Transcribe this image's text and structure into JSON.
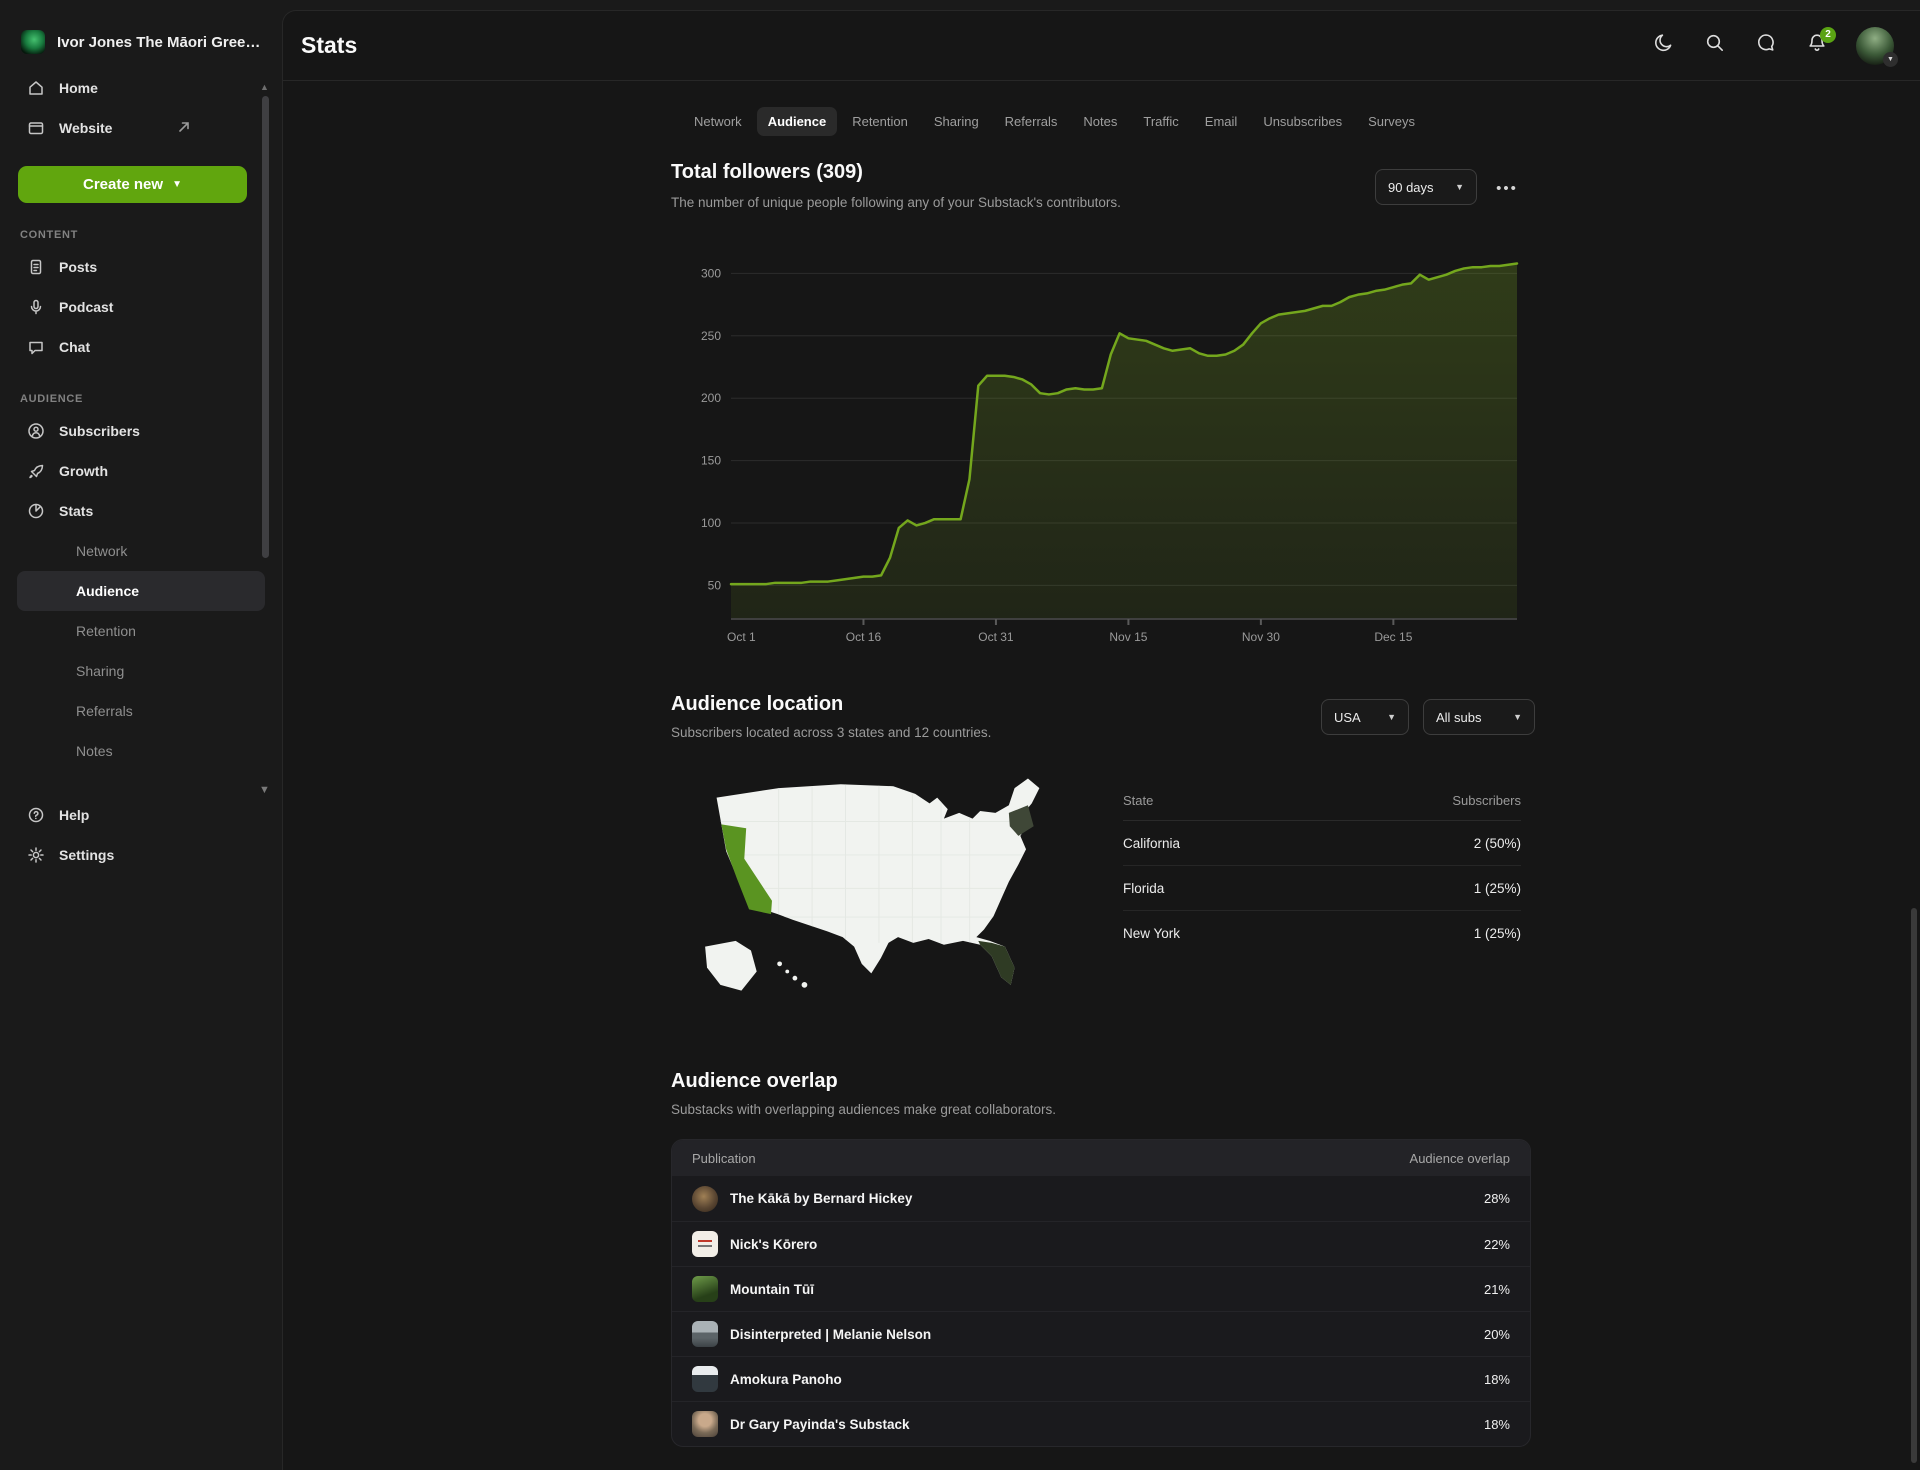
{
  "workspace": {
    "name": "Ivor Jones The Māori Gree…"
  },
  "header": {
    "title": "Stats",
    "notifications_badge": "2"
  },
  "sidebar": {
    "home": "Home",
    "website": "Website",
    "create_new": "Create new",
    "content_label": "CONTENT",
    "posts": "Posts",
    "podcast": "Podcast",
    "chat": "Chat",
    "audience_label": "AUDIENCE",
    "subscribers": "Subscribers",
    "growth": "Growth",
    "stats": "Stats",
    "stats_subitems": [
      "Network",
      "Audience",
      "Retention",
      "Sharing",
      "Referrals",
      "Notes"
    ],
    "active_subitem": "Audience",
    "help": "Help",
    "settings": "Settings"
  },
  "tabs": {
    "items": [
      "Network",
      "Audience",
      "Retention",
      "Sharing",
      "Referrals",
      "Notes",
      "Traffic",
      "Email",
      "Unsubscribes",
      "Surveys"
    ],
    "active": "Audience"
  },
  "followers": {
    "title": "Total followers (309)",
    "subtitle": "The number of unique people following any of your Substack's contributors.",
    "range_selected": "90 days",
    "menu": "•••"
  },
  "chart_data": {
    "type": "area",
    "title": "Total followers (309)",
    "x_unit": "day",
    "values": [
      51,
      51,
      51,
      51,
      51,
      52,
      52,
      52,
      52,
      53,
      53,
      53,
      54,
      55,
      56,
      57,
      57,
      58,
      72,
      96,
      102,
      98,
      100,
      103,
      103,
      103,
      103,
      135,
      210,
      218,
      218,
      218,
      217,
      215,
      211,
      204,
      203,
      204,
      207,
      208,
      207,
      207,
      208,
      235,
      252,
      248,
      247,
      246,
      243,
      240,
      238,
      239,
      240,
      236,
      234,
      234,
      235,
      238,
      243,
      252,
      260,
      264,
      267,
      268,
      269,
      270,
      272,
      274,
      274,
      277,
      281,
      283,
      284,
      286,
      287,
      289,
      291,
      292,
      299,
      295,
      297,
      299,
      302,
      304,
      305,
      305,
      306,
      306,
      307,
      308
    ],
    "xticks": [
      {
        "index": 0,
        "label": "Oct 1"
      },
      {
        "index": 15,
        "label": "Oct 16"
      },
      {
        "index": 30,
        "label": "Oct 31"
      },
      {
        "index": 45,
        "label": "Nov 15"
      },
      {
        "index": 60,
        "label": "Nov 30"
      },
      {
        "index": 75,
        "label": "Dec 15"
      }
    ],
    "yticks": [
      50,
      100,
      150,
      200,
      250,
      300
    ],
    "ylim": [
      23,
      326
    ],
    "grid": true,
    "colors": {
      "line": "#74a71d",
      "fill_top": "rgba(122,168,33,0.26)",
      "fill_bottom": "rgba(122,168,33,0.10)",
      "grid": "#2c2c2c",
      "axis": "#3f3f3f",
      "tick_label": "#9a9a9a"
    }
  },
  "location": {
    "title": "Audience location",
    "subtitle": "Subscribers located across 3 states and 12 countries.",
    "country_selected": "USA",
    "subs_filter_selected": "All subs",
    "map": {
      "base_color": "#f1f3f0",
      "border_color": "#e2e6e1",
      "highlight_colors": {
        "california": "#5a9421",
        "florida": "#2f3b24",
        "new_york": "#3f4737"
      }
    },
    "table": {
      "columns": {
        "state": "State",
        "subscribers": "Subscribers"
      },
      "rows": [
        {
          "state": "California",
          "subscribers": "2 (50%)"
        },
        {
          "state": "Florida",
          "subscribers": "1 (25%)"
        },
        {
          "state": "New York",
          "subscribers": "1 (25%)"
        }
      ]
    }
  },
  "overlap": {
    "title": "Audience overlap",
    "subtitle": "Substacks with overlapping audiences make great collaborators.",
    "table": {
      "columns": {
        "publication": "Publication",
        "overlap": "Audience overlap"
      },
      "rows": [
        {
          "name": "The Kākā by Bernard Hickey",
          "value": "28%"
        },
        {
          "name": "Nick's Kōrero",
          "value": "22%"
        },
        {
          "name": "Mountain Tūī",
          "value": "21%"
        },
        {
          "name": "Disinterpreted | Melanie Nelson",
          "value": "20%"
        },
        {
          "name": "Amokura Panoho",
          "value": "18%"
        },
        {
          "name": "Dr Gary Payinda's Substack",
          "value": "18%"
        }
      ]
    }
  }
}
